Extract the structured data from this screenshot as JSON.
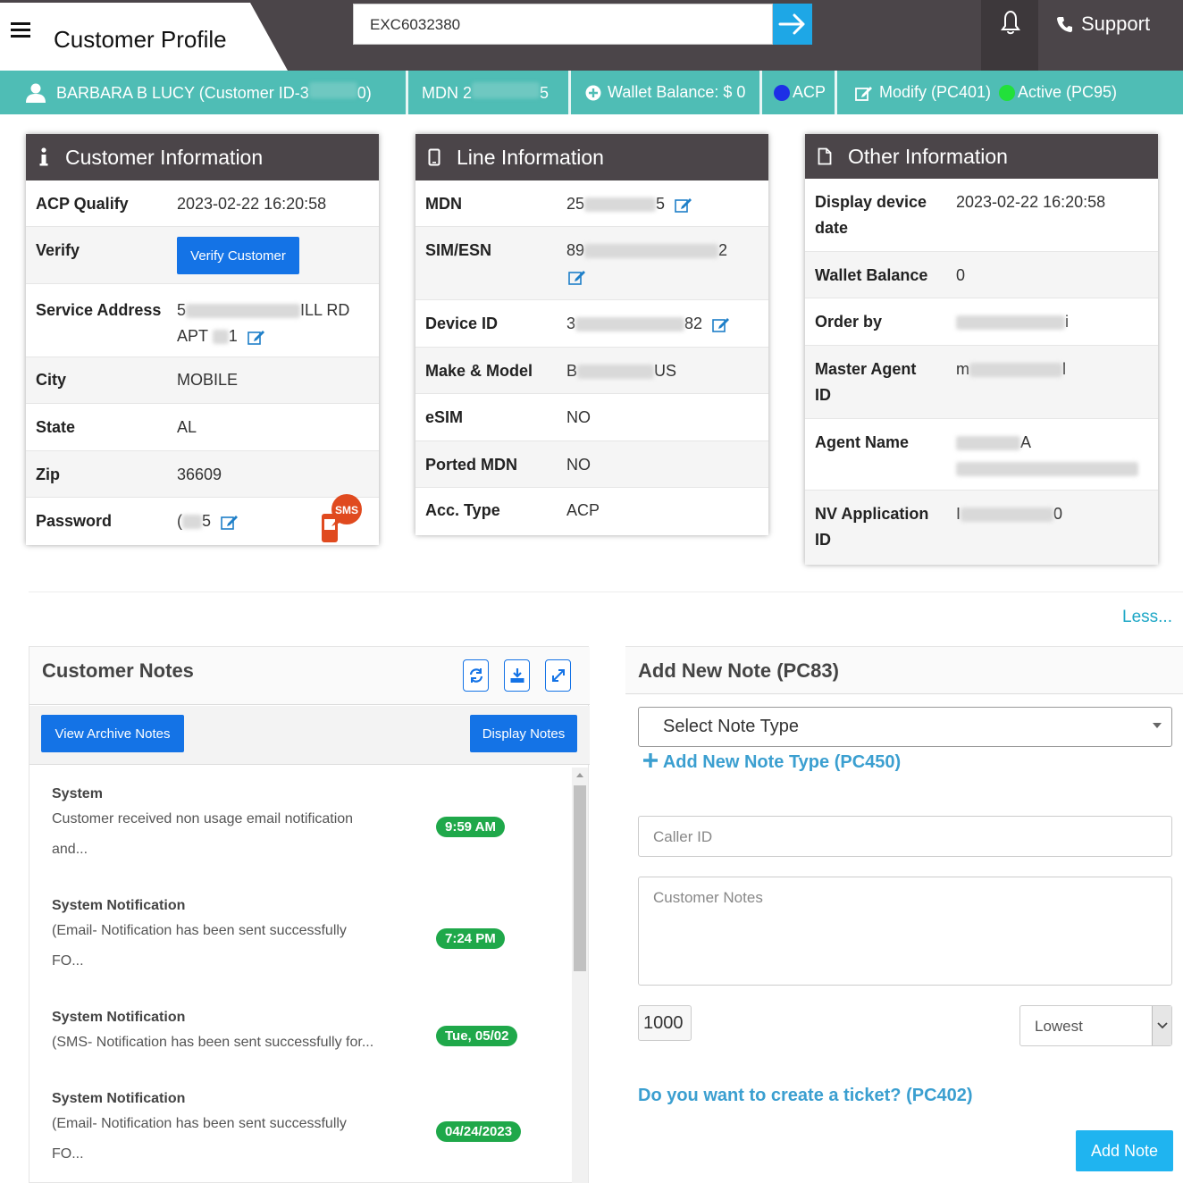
{
  "header": {
    "title": "Customer Profile",
    "search_value": "EXC6032380",
    "support_label": "Support"
  },
  "customer_bar": {
    "name_prefix": "BARBARA B LUCY (Customer ID-3",
    "name_suffix": "0)",
    "mdn_prefix": "MDN 2",
    "mdn_suffix": "5",
    "wallet": "Wallet Balance: $ 0",
    "acp": "ACP",
    "modify": "Modify (PC401)",
    "active": "Active (PC95)"
  },
  "customer_info": {
    "title": "Customer Information",
    "rows": [
      {
        "label": "ACP Qualify",
        "value": "2023-02-22 16:20:58"
      },
      {
        "label": "Verify",
        "value": "Verify Customer"
      },
      {
        "label": "Service Address",
        "value_a": "5",
        "value_b": "ILL RD",
        "value_c": "APT",
        "value_d": "1"
      },
      {
        "label": "City",
        "value": "MOBILE"
      },
      {
        "label": "State",
        "value": "AL"
      },
      {
        "label": "Zip",
        "value": "36609"
      },
      {
        "label": "Password",
        "value_a": "(",
        "value_b": "5"
      }
    ],
    "sms_badge": "SMS"
  },
  "line_info": {
    "title": "Line Information",
    "rows": [
      {
        "label": "MDN",
        "value_a": "25",
        "value_b": "5"
      },
      {
        "label": "SIM/ESN",
        "value_a": "89",
        "value_b": "2"
      },
      {
        "label": "Device ID",
        "value_a": "3",
        "value_b": "82"
      },
      {
        "label": "Make & Model",
        "value_a": "B",
        "value_b": "US"
      },
      {
        "label": "eSIM",
        "value": "NO"
      },
      {
        "label": "Ported MDN",
        "value": "NO"
      },
      {
        "label": "Acc. Type",
        "value": "ACP"
      }
    ]
  },
  "other_info": {
    "title": "Other Information",
    "rows": [
      {
        "label_a": "Display device",
        "label_b": "date",
        "value": "2023-02-22 16:20:58"
      },
      {
        "label": "Wallet Balance",
        "value": "0"
      },
      {
        "label": "Order by",
        "value_b": "i"
      },
      {
        "label_a": "Master Agent",
        "label_b": "ID",
        "value_a": "m",
        "value_b": "l"
      },
      {
        "label": "Agent Name",
        "value_b": "A"
      },
      {
        "label_a": "NV Application",
        "label_b": "ID",
        "value_a": "I",
        "value_b": "0"
      }
    ]
  },
  "less_link": "Less...",
  "notes": {
    "title": "Customer Notes",
    "archive_button": "View Archive Notes",
    "display_button": "Display Notes",
    "items": [
      {
        "title": "System",
        "line1": "Customer received non usage email notification",
        "line2": "and...",
        "time": "9:59 AM"
      },
      {
        "title": "System Notification",
        "line1": "(Email- Notification has been sent successfully",
        "line2": "FO...",
        "time": "7:24 PM"
      },
      {
        "title": "System Notification",
        "line1": "(SMS- Notification has been sent successfully for...",
        "line2": "",
        "time": "Tue, 05/02"
      },
      {
        "title": "System Notification",
        "line1": "(Email- Notification has been sent successfully",
        "line2": "FO...",
        "time": "04/24/2023"
      }
    ]
  },
  "add_note": {
    "title": "Add New Note (PC83)",
    "note_type_placeholder": "Select Note Type",
    "add_type_link": "Add New Note Type (PC450)",
    "caller_id_placeholder": "Caller ID",
    "notes_placeholder": "Customer Notes",
    "char_count": "1000",
    "priority": "Lowest",
    "ticket_link": "Do you want to create a ticket? (PC402)",
    "submit": "Add Note"
  },
  "colors": {
    "header_dark": "#4b4549",
    "teal": "#4fbdb5",
    "primary_blue": "#1473e6",
    "badge_green": "#1fa84a",
    "link_teal": "#3b9fd0"
  }
}
